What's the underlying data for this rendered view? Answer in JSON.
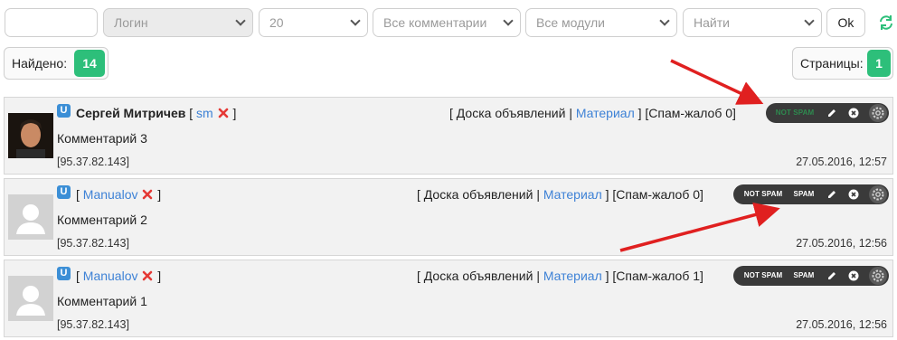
{
  "filters": {
    "search_value": "",
    "login_placeholder": "Логин",
    "per_page": "20",
    "comments_select": "Все комментарии",
    "modules_select": "Все модули",
    "find_select": "Найти",
    "ok_label": "Ok"
  },
  "summary": {
    "found_label": "Найдено:",
    "found_count": "14",
    "pages_label": "Страницы:",
    "pages_count": "1"
  },
  "comments": [
    {
      "author": "Сергей Митричев",
      "bracket_open": "[",
      "user_login": "sm",
      "bracket_close": "]",
      "board": "[ Доска объявлений |",
      "material": "Материал",
      "spam_reports": "] [Спам-жалоб 0]",
      "text": "Комментарий 3",
      "ip": "[95.37.82.143]",
      "date": "27.05.2016, 12:57",
      "not_spam_label": "NOT SPAM"
    },
    {
      "bracket_open": "[",
      "user_login": "Manualov",
      "bracket_close": "]",
      "board": "[ Доска объявлений |",
      "material": "Материал",
      "spam_reports": "] [Спам-жалоб 0]",
      "text": "Комментарий 2",
      "ip": "[95.37.82.143]",
      "date": "27.05.2016, 12:56",
      "not_spam_label": "NOT SPAM",
      "spam_label": "SPAM"
    },
    {
      "bracket_open": "[",
      "user_login": "Manualov",
      "bracket_close": "]",
      "board": "[ Доска объявлений |",
      "material": "Материал",
      "spam_reports": "] [Спам-жалоб 1]",
      "text": "Комментарий 1",
      "ip": "[95.37.82.143]",
      "date": "27.05.2016, 12:56",
      "not_spam_label": "NOT SPAM",
      "spam_label": "SPAM"
    }
  ],
  "colors": {
    "accent_green": "#2dbf7a",
    "link_blue": "#3e82d6",
    "arrow_red": "#e02020",
    "toolbar_dark": "#3a3a3a"
  },
  "icons": [
    "refresh-icon",
    "user-u-icon",
    "delete-x-icon",
    "pencil-icon",
    "close-circle-icon",
    "gear-icon",
    "avatar-placeholder-icon"
  ]
}
